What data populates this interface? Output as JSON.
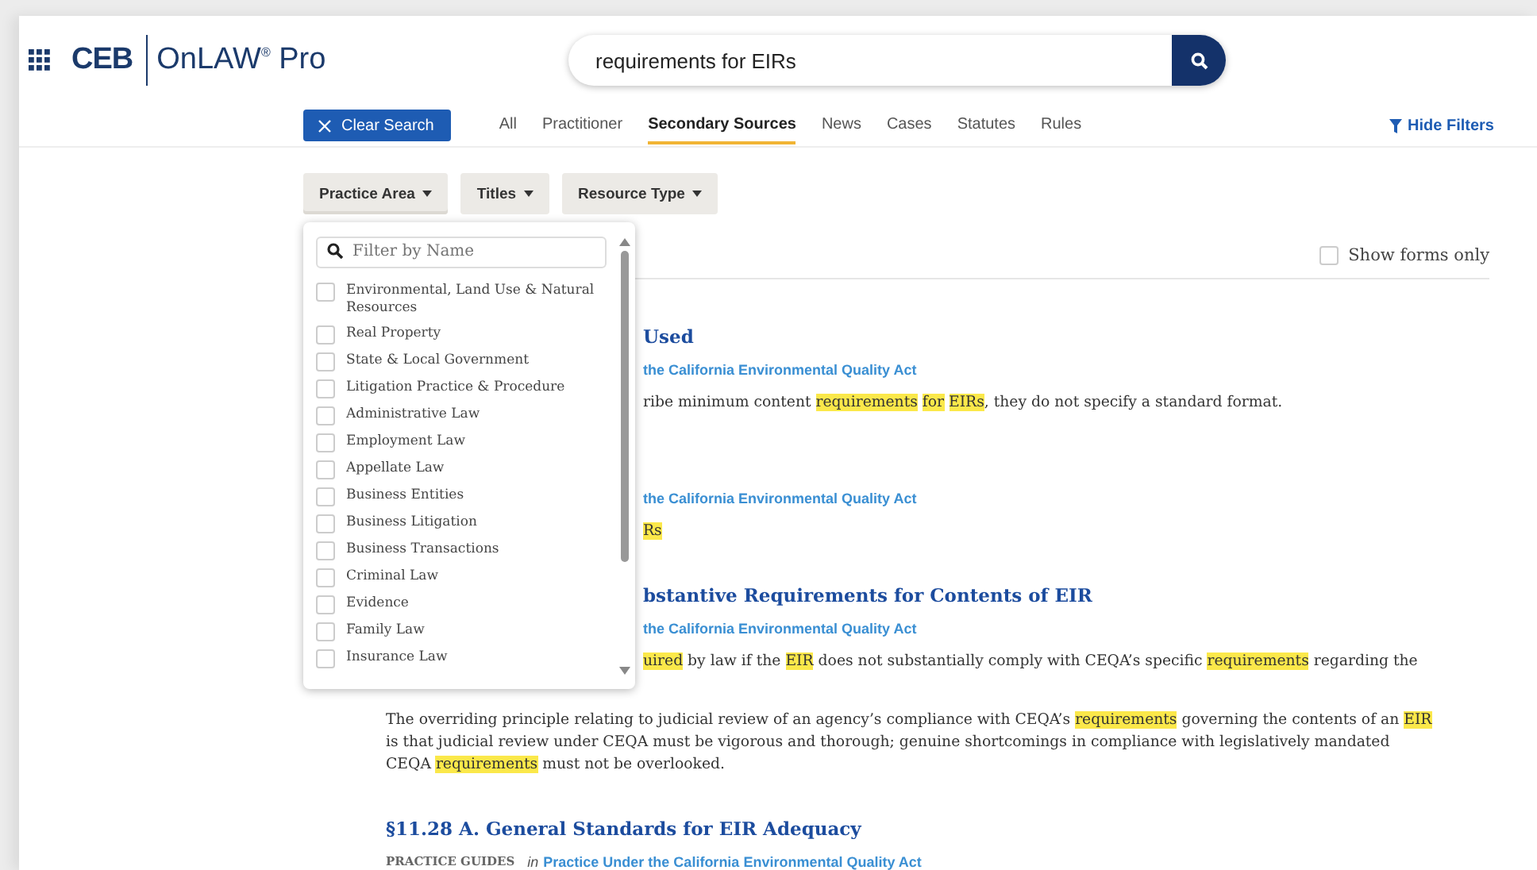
{
  "header": {
    "logo": "CEB",
    "product": "OnLAW$^{®}$ Pro"
  },
  "search": {
    "value": "requirements for EIRs"
  },
  "clear_button": "Clear Search",
  "tabs": [
    {
      "label": "All",
      "selected": false
    },
    {
      "label": "Practitioner",
      "selected": false
    },
    {
      "label": "Secondary Sources",
      "selected": true
    },
    {
      "label": "News",
      "selected": false
    },
    {
      "label": "Cases",
      "selected": false
    },
    {
      "label": "Statutes",
      "selected": false
    },
    {
      "label": "Rules",
      "selected": false
    }
  ],
  "hide_filters": "Hide Filters",
  "filters": [
    {
      "label": "Practice Area",
      "expanded": true
    },
    {
      "label": "Titles",
      "expanded": false
    },
    {
      "label": "Resource Type",
      "expanded": false
    }
  ],
  "practice_area_menu": {
    "placeholder": "Filter by Name",
    "options": [
      {
        "label": "Environmental, Land Use & Natural Resources",
        "checked": false
      },
      {
        "label": "Real Property",
        "checked": false
      },
      {
        "label": "State & Local Government",
        "checked": false
      },
      {
        "label": "Litigation Practice & Procedure",
        "checked": false
      },
      {
        "label": "Administrative Law",
        "checked": false
      },
      {
        "label": "Employment Law",
        "checked": false
      },
      {
        "label": "Appellate Law",
        "checked": false
      },
      {
        "label": "Business Entities",
        "checked": false
      },
      {
        "label": "Business Litigation",
        "checked": false
      },
      {
        "label": "Business Transactions",
        "checked": false
      },
      {
        "label": "Criminal Law",
        "checked": false
      },
      {
        "label": "Evidence",
        "checked": false
      },
      {
        "label": "Family Law",
        "checked": false
      },
      {
        "label": "Insurance Law",
        "checked": false
      }
    ]
  },
  "show_forms_only": {
    "label": "Show forms only",
    "checked": false
  },
  "results": [
    {
      "lines": [
        {
          "kind": "title",
          "text": "Used",
          "covered": true
        },
        {
          "kind": "source",
          "text": "the California Environmental Quality Act",
          "covered": true
        },
        {
          "kind": "snippet",
          "text": "ribe minimum content **requirements** **for** **EIRs**, they do not specify a standard format.",
          "covered": true
        }
      ]
    },
    {
      "lines": [
        {
          "kind": "gap"
        },
        {
          "kind": "source",
          "text": "the California Environmental Quality Act",
          "covered": true
        },
        {
          "kind": "snippet",
          "text": "**Rs**",
          "covered": true
        }
      ]
    },
    {
      "lines": [
        {
          "kind": "title",
          "text": "bstantive Requirements for Contents of EIR",
          "covered": true
        },
        {
          "kind": "source",
          "text": "the California Environmental Quality Act",
          "covered": true
        },
        {
          "kind": "snippet",
          "text": "**uired** by law if the **EIR** does not substantially comply with CEQA’s specific **requirements** regarding the",
          "covered": true
        },
        {
          "kind": "gap"
        },
        {
          "kind": "paragraph",
          "text": "The overriding principle relating to judicial review of an agency’s compliance with CEQA’s **requirements** governing the contents of an **EIR** is that judicial review under CEQA must be vigorous and thorough; genuine shortcomings in compliance with legislatively mandated CEQA **requirements** must not be overlooked.",
          "covered": false
        }
      ]
    },
    {
      "lines": [
        {
          "kind": "title",
          "text": "§11.28 A. General Standards for EIR Adequacy",
          "covered": false
        },
        {
          "kind": "meta",
          "category": "PRACTICE GUIDES",
          "prefix": "in",
          "text": "Practice Under the California Environmental Quality Act",
          "covered": false
        }
      ]
    }
  ]
}
